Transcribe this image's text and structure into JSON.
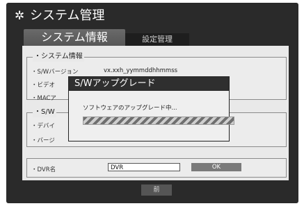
{
  "window": {
    "title": "システム管理",
    "icon": "gear-icon"
  },
  "tabs": [
    {
      "label": "システム情報",
      "active": true
    },
    {
      "label": "設定管理",
      "active": false
    }
  ],
  "system_info_group": {
    "title": "・システム情報",
    "rows": [
      {
        "label": "・S/Wバージョン",
        "value": "vx.xxh_yymmddhhmmss"
      },
      {
        "label": "・ビデオ",
        "value": ""
      },
      {
        "label": "・MACア",
        "value": ""
      }
    ]
  },
  "sw_group": {
    "title": "・S/W",
    "rows": [
      {
        "label": "・デバイ"
      },
      {
        "label": "・バージ"
      }
    ]
  },
  "dvr_group": {
    "label": "・DVR名",
    "input_value": "DVR",
    "ok_label": "OK"
  },
  "footer": {
    "prev_label": "前"
  },
  "dialog": {
    "title": "S/Wアップグレード",
    "message": "ソフトウェアのアップグレード中...",
    "progress": 1.0
  }
}
